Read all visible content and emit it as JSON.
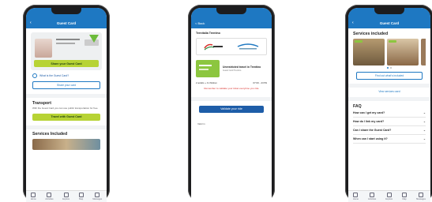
{
  "phone1": {
    "title": "Guest Card",
    "share_button": "Share your Guest Card",
    "what_is_link": "What is the Guest Card?",
    "share_card_button": "Share your card",
    "transport_heading": "Transport",
    "transport_text": "With the Guest Card you can use public transportation for free.",
    "travel_button": "Travel with Guest Card",
    "services_heading": "Services Included",
    "tabs": [
      "Home",
      "Activities",
      "Explore",
      "Map",
      "Messages"
    ]
  },
  "phone2": {
    "back_label": "< Back",
    "operator_title": "Trenitalia Trentino",
    "ticket_title": "Unrestricted travel in Trentino",
    "ticket_subtitle": "Guest Card Trentino",
    "validity": "2 adults + 0 children",
    "time": "07:00 - 23:59",
    "warning": "Remember to validate your ticket everytime you ride",
    "validate_button": "Validate your ride",
    "footer_label": "Valid in"
  },
  "phone3": {
    "title": "Guest Card",
    "services_heading": "Services included",
    "find_out_button": "Find out what's included",
    "view_services_link": "View services used",
    "faq_heading": "FAQ",
    "faq": [
      "How can I get my card?",
      "How do I link my card?",
      "Can I share the Guest Card?",
      "When can I start using it?"
    ],
    "tabs": [
      "Home",
      "Activities",
      "Explore",
      "Map",
      "Messages"
    ]
  },
  "colors": {
    "brand_blue": "#1e78c2",
    "accent_green": "#b7d334",
    "warning_red": "#d9302c"
  }
}
